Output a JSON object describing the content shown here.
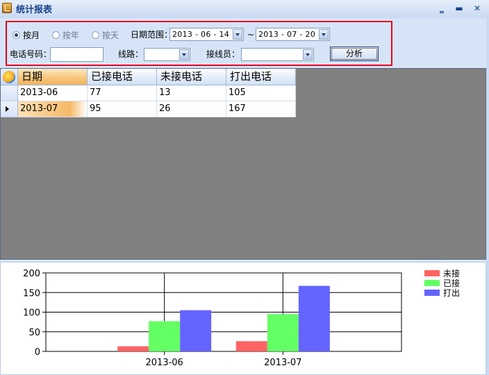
{
  "window": {
    "title": "统计报表",
    "controls": {
      "minimize": "‗",
      "maximize": "▬",
      "close": "✕"
    }
  },
  "filter": {
    "mode_options": [
      {
        "label": "按月",
        "selected": true
      },
      {
        "label": "按年",
        "selected": false
      },
      {
        "label": "按天",
        "selected": false
      }
    ],
    "date_range_label": "日期范围：",
    "date_from": "2013 - 06 - 14",
    "date_sep": "~",
    "date_to": "2013 - 07 - 20",
    "phone_label": "电话号码：",
    "phone_value": "",
    "line_label": "线路：",
    "line_value": "",
    "operator_label": "接线员：",
    "operator_value": "",
    "analyze_label": "分析"
  },
  "grid": {
    "columns": [
      "日期",
      "已接电话",
      "未接电话",
      "打出电话"
    ],
    "rows": [
      [
        "2013-06",
        "77",
        "13",
        "105"
      ],
      [
        "2013-07",
        "95",
        "26",
        "167"
      ]
    ],
    "current_row": 1
  },
  "chart_data": {
    "type": "bar",
    "categories": [
      "2013-06",
      "2013-07"
    ],
    "series": [
      {
        "name": "未接",
        "values": [
          13,
          26
        ],
        "color": "#ff6464"
      },
      {
        "name": "已接",
        "values": [
          77,
          95
        ],
        "color": "#64ff64"
      },
      {
        "name": "打出",
        "values": [
          105,
          167
        ],
        "color": "#6464ff"
      }
    ],
    "ylim": [
      0,
      200
    ],
    "yticks": [
      0,
      50,
      100,
      150,
      200
    ],
    "title": "",
    "xlabel": "",
    "ylabel": "",
    "grid": true,
    "legend_position": "top-right"
  }
}
